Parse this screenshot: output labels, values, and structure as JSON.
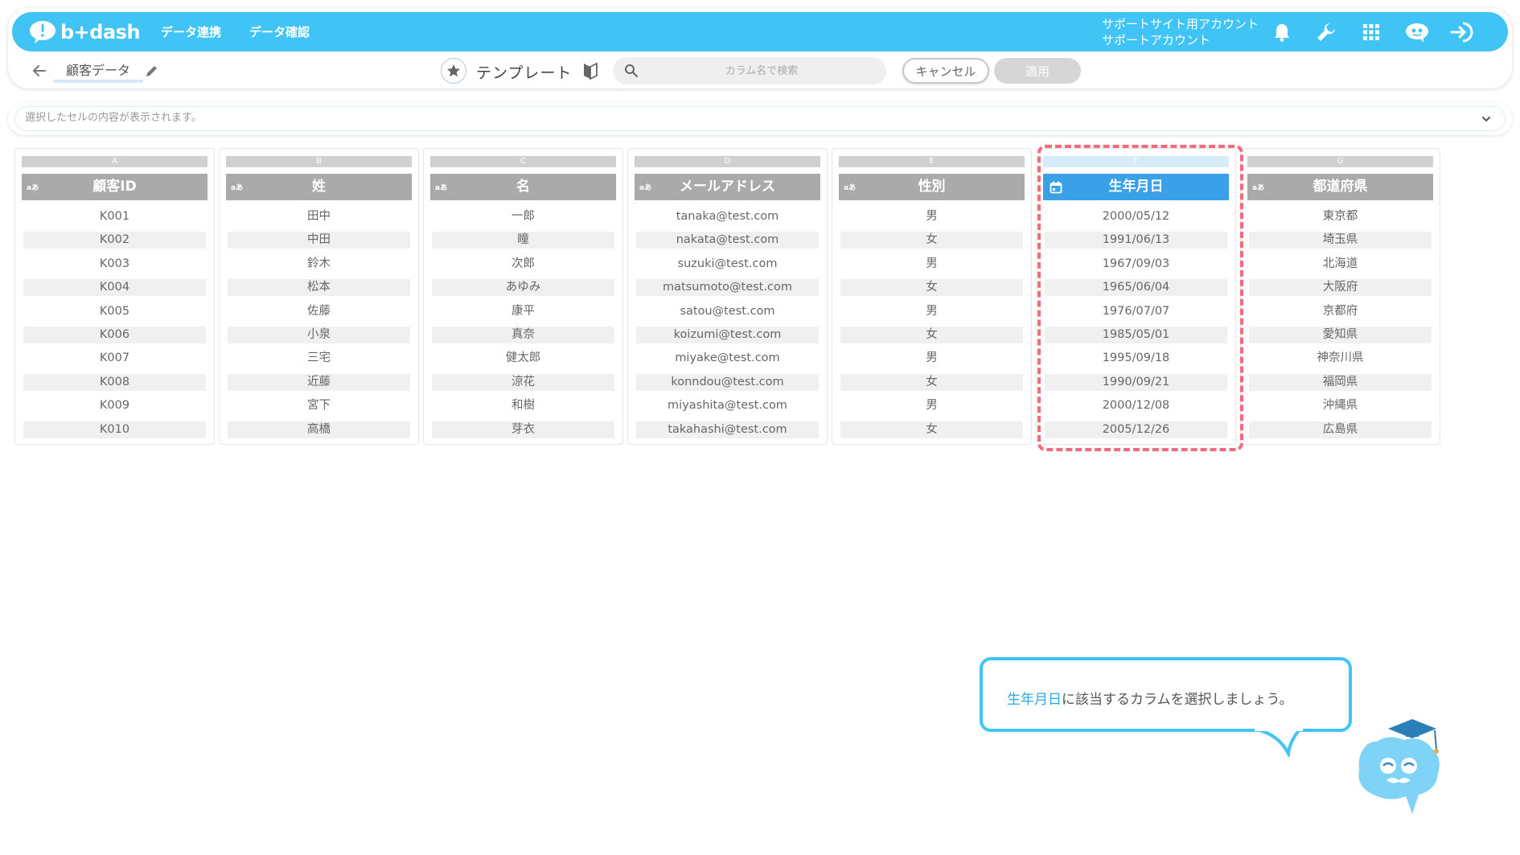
{
  "header": {
    "logo_text": "b+dash",
    "nav": [
      "データ連携",
      "データ確認"
    ],
    "account_line1": "サポートサイト用アカウント",
    "account_line2": "サポートアカウント"
  },
  "toolbar": {
    "doc_title": "顧客データ",
    "template_label": "テンプレート",
    "search_placeholder": "カラム名で検索",
    "cancel_label": "キャンセル",
    "apply_label": "適用"
  },
  "cell_bar": {
    "placeholder": "選択したセルの内容が表示されます。"
  },
  "columns": [
    {
      "letter": "A",
      "type": "aあ",
      "name": "顧客ID",
      "cells": [
        "K001",
        "K002",
        "K003",
        "K004",
        "K005",
        "K006",
        "K007",
        "K008",
        "K009",
        "K010"
      ]
    },
    {
      "letter": "B",
      "type": "aあ",
      "name": "姓",
      "cells": [
        "田中",
        "中田",
        "鈴木",
        "松本",
        "佐藤",
        "小泉",
        "三宅",
        "近藤",
        "宮下",
        "高橋"
      ]
    },
    {
      "letter": "C",
      "type": "aあ",
      "name": "名",
      "cells": [
        "一郎",
        "瞳",
        "次郎",
        "あゆみ",
        "康平",
        "真奈",
        "健太郎",
        "涼花",
        "和樹",
        "芽衣"
      ]
    },
    {
      "letter": "D",
      "type": "aあ",
      "name": "メールアドレス",
      "cells": [
        "tanaka@test.com",
        "nakata@test.com",
        "suzuki@test.com",
        "matsumoto@test.com",
        "satou@test.com",
        "koizumi@test.com",
        "miyake@test.com",
        "konndou@test.com",
        "miyashita@test.com",
        "takahashi@test.com"
      ]
    },
    {
      "letter": "E",
      "type": "aあ",
      "name": "性別",
      "cells": [
        "男",
        "女",
        "男",
        "女",
        "男",
        "女",
        "男",
        "女",
        "男",
        "女"
      ]
    },
    {
      "letter": "F",
      "type": "calendar",
      "name": "生年月日",
      "cells": [
        "2000/05/12",
        "1991/06/13",
        "1967/09/03",
        "1965/06/04",
        "1976/07/07",
        "1985/05/01",
        "1995/09/18",
        "1990/09/21",
        "2000/12/08",
        "2005/12/26"
      ]
    },
    {
      "letter": "G",
      "type": "aあ",
      "name": "都道府県",
      "cells": [
        "東京都",
        "埼玉県",
        "北海道",
        "大阪府",
        "京都府",
        "愛知県",
        "神奈川県",
        "福岡県",
        "沖縄県",
        "広島県"
      ]
    }
  ],
  "tooltip": {
    "highlight": "生年月日",
    "text": "に該当するカラムを選択しましょう。"
  },
  "colors": {
    "brand": "#40c4f5",
    "selected_header": "#3aa0e8",
    "highlight_dash": "#f26b7c",
    "column_header": "#aaaaaa"
  }
}
